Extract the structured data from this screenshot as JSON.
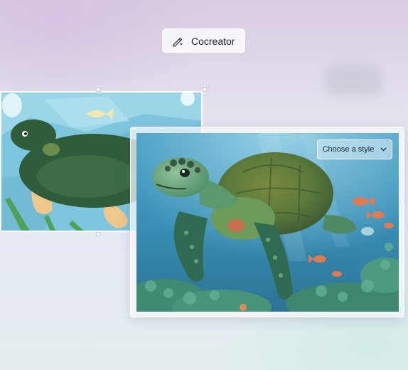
{
  "cocreator_chip": {
    "label": "Cocreator",
    "icon": "pen-sparkle-icon"
  },
  "sketch_canvas": {
    "description_icon": "turtle-sketch"
  },
  "generated_image": {
    "style_dropdown": {
      "label": "Choose a style",
      "icon": "chevron-down-icon"
    }
  },
  "colors": {
    "accent_ocean": "#2e8bb3",
    "turtle_green": "#4f8a5b"
  }
}
